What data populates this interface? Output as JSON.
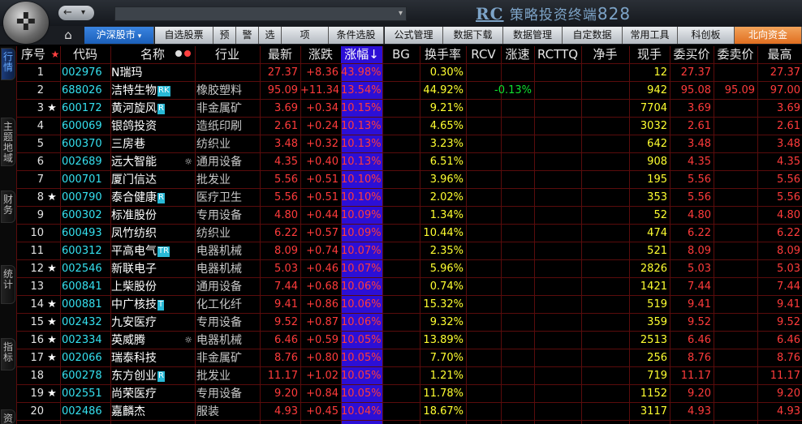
{
  "titlebar": {
    "brand_rc": "RC",
    "brand_name": "策略投资终端",
    "brand_num": "828",
    "back_icon": "←",
    "dropdown_icon": "▾",
    "address_value": ""
  },
  "menubar": {
    "home_icon": "⌂",
    "items": [
      "沪深股市",
      "自选股票",
      "预",
      "警",
      "选",
      "项",
      "条件选股",
      "公式管理",
      "数据下载",
      "数据管理",
      "自定数据",
      "常用工具",
      "科创板",
      "北向资金"
    ],
    "market_arrow": "▾"
  },
  "lefttabs": [
    "行情",
    "主题地域",
    "财务",
    "统计",
    "指标",
    "资"
  ],
  "table": {
    "headers": [
      "序号",
      "★",
      "代码",
      "名称",
      "行业",
      "最新",
      "涨跌",
      "涨幅↓",
      "BG",
      "换手率",
      "RCV",
      "涨速",
      "RCTTQ",
      "净手",
      "现手",
      "委买价",
      "委卖价",
      "最高"
    ],
    "rows": [
      {
        "n": "1",
        "star": "",
        "code": "002976",
        "name": "N瑞玛",
        "badge": "",
        "gear": "",
        "ind": "",
        "last": "27.37",
        "chg": "+8.36",
        "pct": "43.98%",
        "turn": "0.30%",
        "speed": "",
        "vol": "12",
        "bid": "27.37",
        "ask": "",
        "high": "27.37"
      },
      {
        "n": "2",
        "star": "",
        "code": "688026",
        "name": "洁特生物",
        "badge": "RK",
        "gear": "",
        "ind": "橡胶塑料",
        "last": "95.09",
        "chg": "+11.34",
        "pct": "13.54%",
        "turn": "44.92%",
        "speed": "-0.13%",
        "vol": "942",
        "bid": "95.08",
        "ask": "95.09",
        "high": "97.00"
      },
      {
        "n": "3",
        "star": "★",
        "code": "600172",
        "name": "黄河旋风",
        "badge": "R",
        "gear": "",
        "ind": "非金属矿",
        "last": "3.69",
        "chg": "+0.34",
        "pct": "10.15%",
        "turn": "9.21%",
        "speed": "",
        "vol": "7704",
        "bid": "3.69",
        "ask": "",
        "high": "3.69"
      },
      {
        "n": "4",
        "star": "",
        "code": "600069",
        "name": "银鸽投资",
        "badge": "",
        "gear": "",
        "ind": "造纸印刷",
        "last": "2.61",
        "chg": "+0.24",
        "pct": "10.13%",
        "turn": "4.65%",
        "speed": "",
        "vol": "3032",
        "bid": "2.61",
        "ask": "",
        "high": "2.61"
      },
      {
        "n": "5",
        "star": "",
        "code": "600370",
        "name": "三房巷",
        "badge": "",
        "gear": "",
        "ind": "纺织业",
        "last": "3.48",
        "chg": "+0.32",
        "pct": "10.13%",
        "turn": "3.23%",
        "speed": "",
        "vol": "642",
        "bid": "3.48",
        "ask": "",
        "high": "3.48"
      },
      {
        "n": "6",
        "star": "",
        "code": "002689",
        "name": "远大智能",
        "badge": "",
        "gear": "☼",
        "ind": "通用设备",
        "last": "4.35",
        "chg": "+0.40",
        "pct": "10.13%",
        "turn": "6.51%",
        "speed": "",
        "vol": "908",
        "bid": "4.35",
        "ask": "",
        "high": "4.35"
      },
      {
        "n": "7",
        "star": "",
        "code": "000701",
        "name": "厦门信达",
        "badge": "",
        "gear": "",
        "ind": "批发业",
        "last": "5.56",
        "chg": "+0.51",
        "pct": "10.10%",
        "turn": "3.96%",
        "speed": "",
        "vol": "195",
        "bid": "5.56",
        "ask": "",
        "high": "5.56"
      },
      {
        "n": "8",
        "star": "★",
        "code": "000790",
        "name": "泰合健康",
        "badge": "R",
        "gear": "",
        "ind": "医疗卫生",
        "last": "5.56",
        "chg": "+0.51",
        "pct": "10.10%",
        "turn": "2.02%",
        "speed": "",
        "vol": "353",
        "bid": "5.56",
        "ask": "",
        "high": "5.56"
      },
      {
        "n": "9",
        "star": "",
        "code": "600302",
        "name": "标准股份",
        "badge": "",
        "gear": "",
        "ind": "专用设备",
        "last": "4.80",
        "chg": "+0.44",
        "pct": "10.09%",
        "turn": "1.34%",
        "speed": "",
        "vol": "52",
        "bid": "4.80",
        "ask": "",
        "high": "4.80"
      },
      {
        "n": "10",
        "star": "",
        "code": "600493",
        "name": "凤竹纺织",
        "badge": "",
        "gear": "",
        "ind": "纺织业",
        "last": "6.22",
        "chg": "+0.57",
        "pct": "10.09%",
        "turn": "10.44%",
        "speed": "",
        "vol": "474",
        "bid": "6.22",
        "ask": "",
        "high": "6.22"
      },
      {
        "n": "11",
        "star": "",
        "code": "600312",
        "name": "平高电气",
        "badge": "TR",
        "gear": "",
        "ind": "电器机械",
        "last": "8.09",
        "chg": "+0.74",
        "pct": "10.07%",
        "turn": "2.35%",
        "speed": "",
        "vol": "521",
        "bid": "8.09",
        "ask": "",
        "high": "8.09"
      },
      {
        "n": "12",
        "star": "★",
        "code": "002546",
        "name": "新联电子",
        "badge": "",
        "gear": "",
        "ind": "电器机械",
        "last": "5.03",
        "chg": "+0.46",
        "pct": "10.07%",
        "turn": "5.96%",
        "speed": "",
        "vol": "2826",
        "bid": "5.03",
        "ask": "",
        "high": "5.03"
      },
      {
        "n": "13",
        "star": "",
        "code": "600841",
        "name": "上柴股份",
        "badge": "",
        "gear": "",
        "ind": "通用设备",
        "last": "7.44",
        "chg": "+0.68",
        "pct": "10.06%",
        "turn": "0.74%",
        "speed": "",
        "vol": "1421",
        "bid": "7.44",
        "ask": "",
        "high": "7.44"
      },
      {
        "n": "14",
        "star": "★",
        "code": "000881",
        "name": "中广核技",
        "badge": "T",
        "gear": "",
        "ind": "化工化纤",
        "last": "9.41",
        "chg": "+0.86",
        "pct": "10.06%",
        "turn": "15.32%",
        "speed": "",
        "vol": "519",
        "bid": "9.41",
        "ask": "",
        "high": "9.41"
      },
      {
        "n": "15",
        "star": "★",
        "code": "002432",
        "name": "九安医疗",
        "badge": "",
        "gear": "",
        "ind": "专用设备",
        "last": "9.52",
        "chg": "+0.87",
        "pct": "10.06%",
        "turn": "9.32%",
        "speed": "",
        "vol": "359",
        "bid": "9.52",
        "ask": "",
        "high": "9.52"
      },
      {
        "n": "16",
        "star": "★",
        "code": "002334",
        "name": "英威腾",
        "badge": "",
        "gear": "☼",
        "ind": "电器机械",
        "last": "6.46",
        "chg": "+0.59",
        "pct": "10.05%",
        "turn": "13.89%",
        "speed": "",
        "vol": "2513",
        "bid": "6.46",
        "ask": "",
        "high": "6.46"
      },
      {
        "n": "17",
        "star": "★",
        "code": "002066",
        "name": "瑞泰科技",
        "badge": "",
        "gear": "",
        "ind": "非金属矿",
        "last": "8.76",
        "chg": "+0.80",
        "pct": "10.05%",
        "turn": "7.70%",
        "speed": "",
        "vol": "256",
        "bid": "8.76",
        "ask": "",
        "high": "8.76"
      },
      {
        "n": "18",
        "star": "",
        "code": "600278",
        "name": "东方创业",
        "badge": "R",
        "gear": "",
        "ind": "批发业",
        "last": "11.17",
        "chg": "+1.02",
        "pct": "10.05%",
        "turn": "1.21%",
        "speed": "",
        "vol": "719",
        "bid": "11.17",
        "ask": "",
        "high": "11.17"
      },
      {
        "n": "19",
        "star": "★",
        "code": "002551",
        "name": "尚荣医疗",
        "badge": "",
        "gear": "",
        "ind": "专用设备",
        "last": "9.20",
        "chg": "+0.84",
        "pct": "10.05%",
        "turn": "11.78%",
        "speed": "",
        "vol": "1152",
        "bid": "9.20",
        "ask": "",
        "high": "9.20"
      },
      {
        "n": "20",
        "star": "",
        "code": "002486",
        "name": "嘉麟杰",
        "badge": "",
        "gear": "",
        "ind": "服装",
        "last": "4.93",
        "chg": "+0.45",
        "pct": "10.04%",
        "turn": "18.67%",
        "speed": "",
        "vol": "3117",
        "bid": "4.93",
        "ask": "",
        "high": "4.93"
      }
    ]
  },
  "colors": {
    "background": "#000000",
    "grid": "#5a0c0c",
    "sort_column": "#2c0fd6",
    "up": "#ff3b3b",
    "turnover": "#ffff30",
    "code": "#35e0ef",
    "speed": "#10e030",
    "badge": "#29b9d6"
  }
}
